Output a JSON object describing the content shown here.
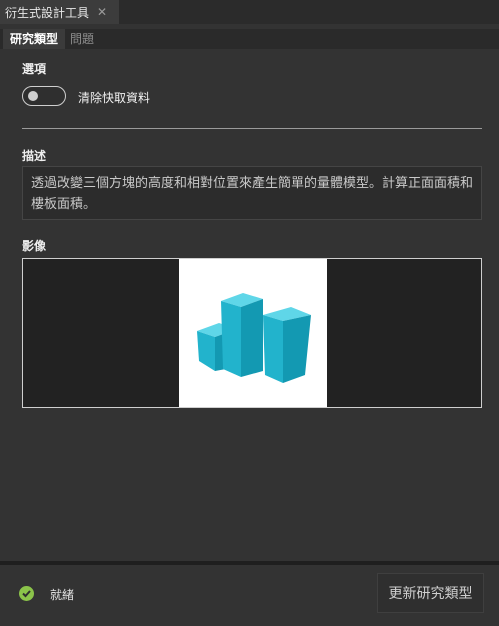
{
  "window": {
    "tab_title": "衍生式設計工具",
    "close_glyph": "✕"
  },
  "tabs": [
    {
      "label": "研究類型",
      "active": true
    },
    {
      "label": "問題",
      "active": false
    }
  ],
  "options": {
    "heading": "選項",
    "toggle_label": "清除快取資料",
    "toggle_on": false
  },
  "description": {
    "heading": "描述",
    "text": "透過改變三個方塊的高度和相對位置來產生簡單的量體模型。計算正面面積和樓板面積。"
  },
  "image": {
    "heading": "影像",
    "subject": "cyan-block-massing-model",
    "color": "#1fb6cf"
  },
  "status": {
    "icon": "check-circle-icon",
    "text": "就緒",
    "color": "#8bc34a"
  },
  "footer": {
    "update_button": "更新研究類型"
  }
}
